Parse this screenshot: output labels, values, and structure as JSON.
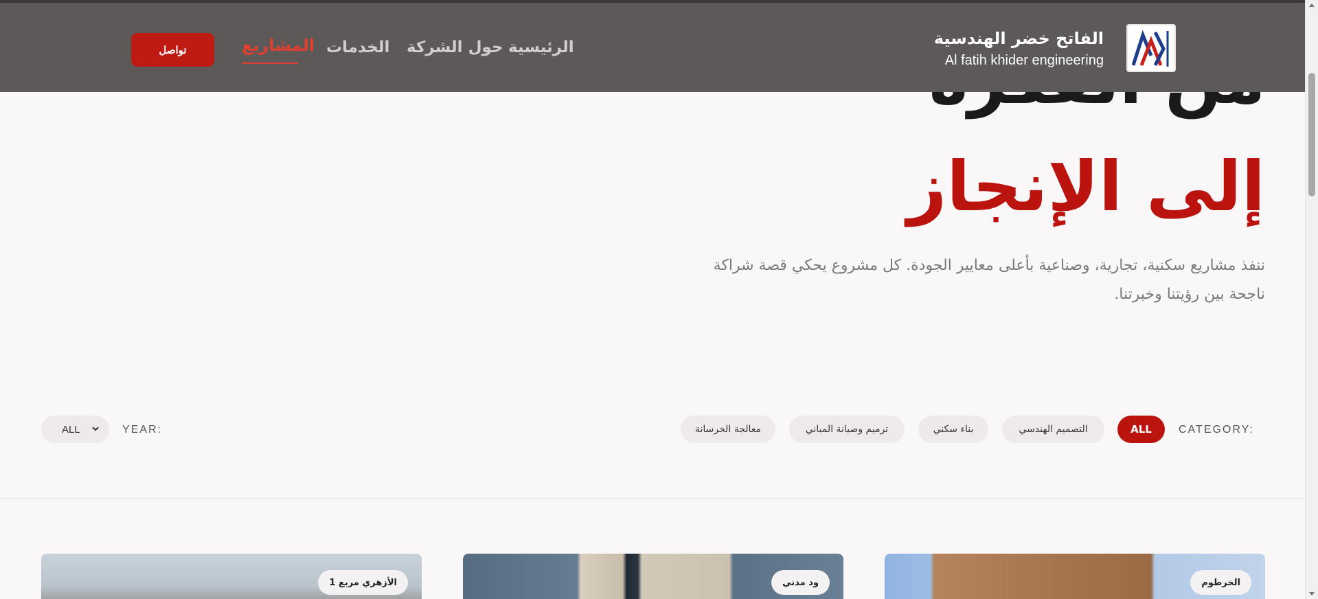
{
  "header": {
    "logo_ar": "الفاتح خضر الهندسية",
    "logo_en": "Al fatih khider engineering",
    "nav": [
      "الرئيسية",
      "حول الشركة",
      "الخدمات",
      "المشاريع"
    ],
    "contact_label": "تواصل"
  },
  "hero": {
    "line1": "من الفكرة",
    "line2": "إلى الإنجاز",
    "description": "ننفذ مشاريع سكنية، تجارية، وصناعية بأعلى معايير الجودة. كل مشروع يحكي قصة شراكة ناجحة بين رؤيتنا وخبرتنا."
  },
  "filters": {
    "category_label": "CATEGORY:",
    "categories": [
      "ALL",
      "التصميم الهندسي",
      "بناء سكني",
      "ترميم وصيانة المباني",
      "معالجة الخرسانة"
    ],
    "year_label": "YEAR:",
    "year_value": "ALL"
  },
  "projects": [
    {
      "location": "الخرطوم"
    },
    {
      "location": "ود مدني"
    },
    {
      "location": "الأزهري مربع 1"
    }
  ],
  "colors": {
    "header_bg": "#5d5958",
    "accent": "#bb140f",
    "nav_active": "#e0402f"
  }
}
